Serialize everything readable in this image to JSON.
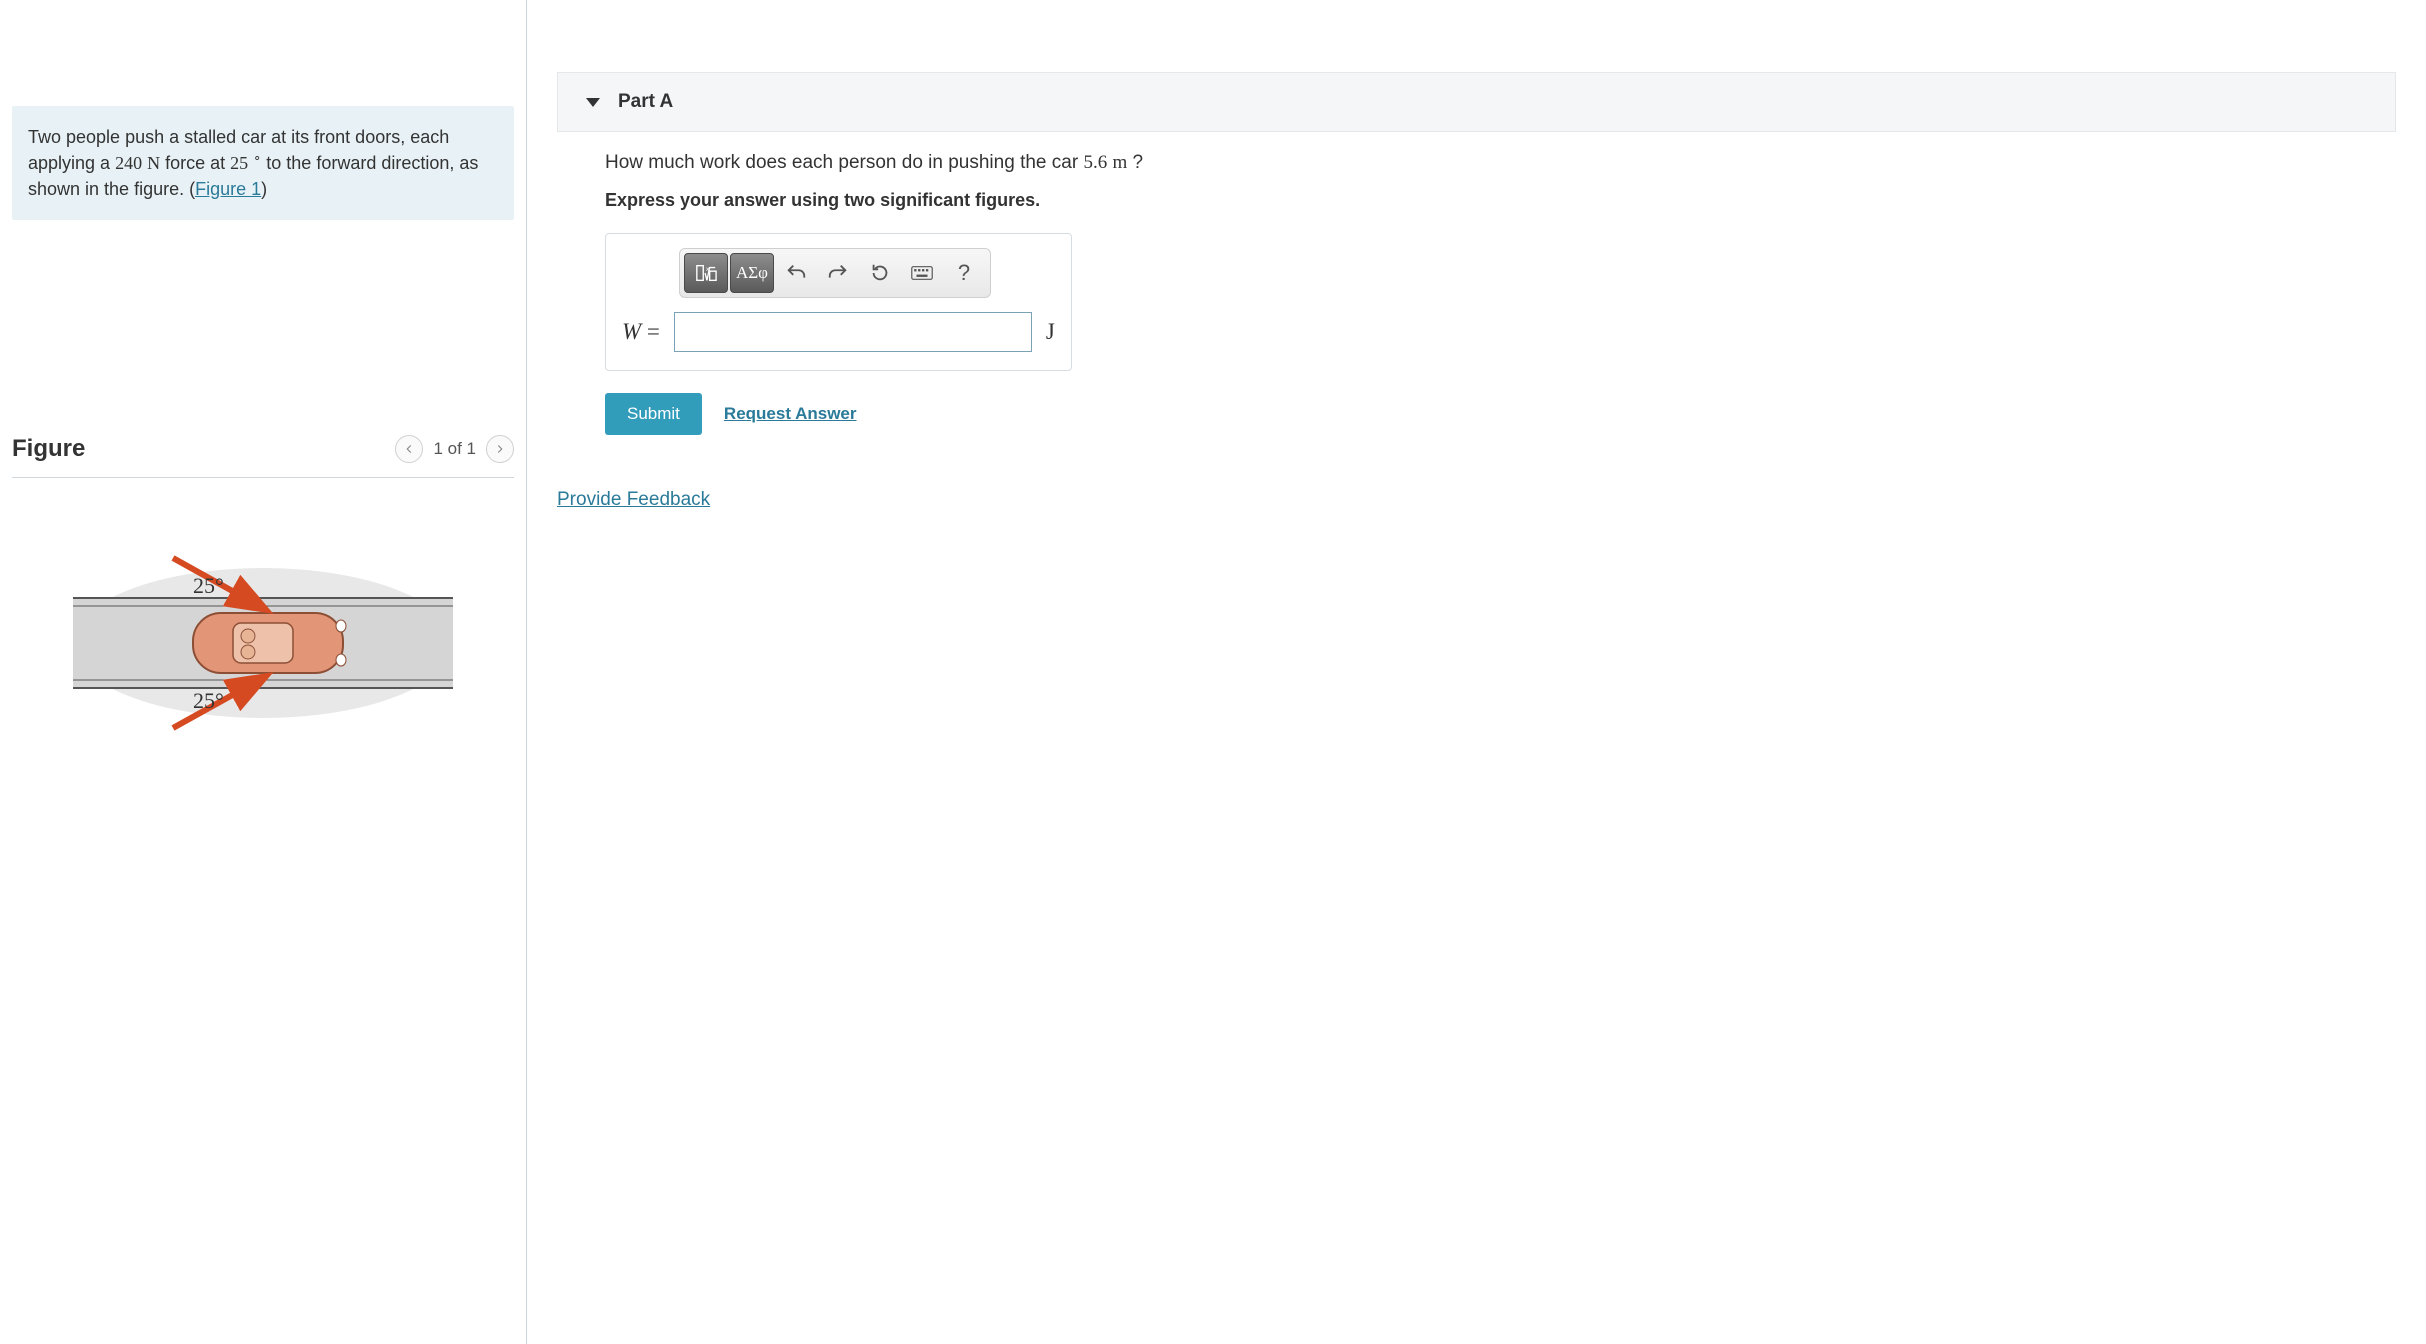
{
  "problem": {
    "text_before_force": "Two people push a stalled car at its front doors, each applying a ",
    "force_value": "240",
    "force_unit": "N",
    "text_mid1": " force at ",
    "angle_value": "25",
    "degree": "∘",
    "text_mid2": " to the forward direction, as shown in the figure. (",
    "figure_link": "Figure 1",
    "text_after": ")"
  },
  "figure": {
    "title": "Figure",
    "page_label": "1 of 1",
    "angle_label_top": "25°",
    "angle_label_bottom": "25°"
  },
  "part": {
    "label": "Part A",
    "question_before": "How much work does each person do in pushing the car ",
    "distance_value": "5.6",
    "distance_unit": "m",
    "question_after": " ?",
    "instruction": "Express your answer using two significant figures."
  },
  "toolbar": {
    "templates": "▢√▢",
    "greek": "ΑΣφ",
    "undo": "↶",
    "redo": "↷",
    "reset": "↺",
    "keyboard": "⌨",
    "help": "?"
  },
  "answer": {
    "variable": "W",
    "equals": " = ",
    "unit": "J"
  },
  "actions": {
    "submit": "Submit",
    "request": "Request Answer"
  },
  "feedback": {
    "link": "Provide Feedback"
  }
}
